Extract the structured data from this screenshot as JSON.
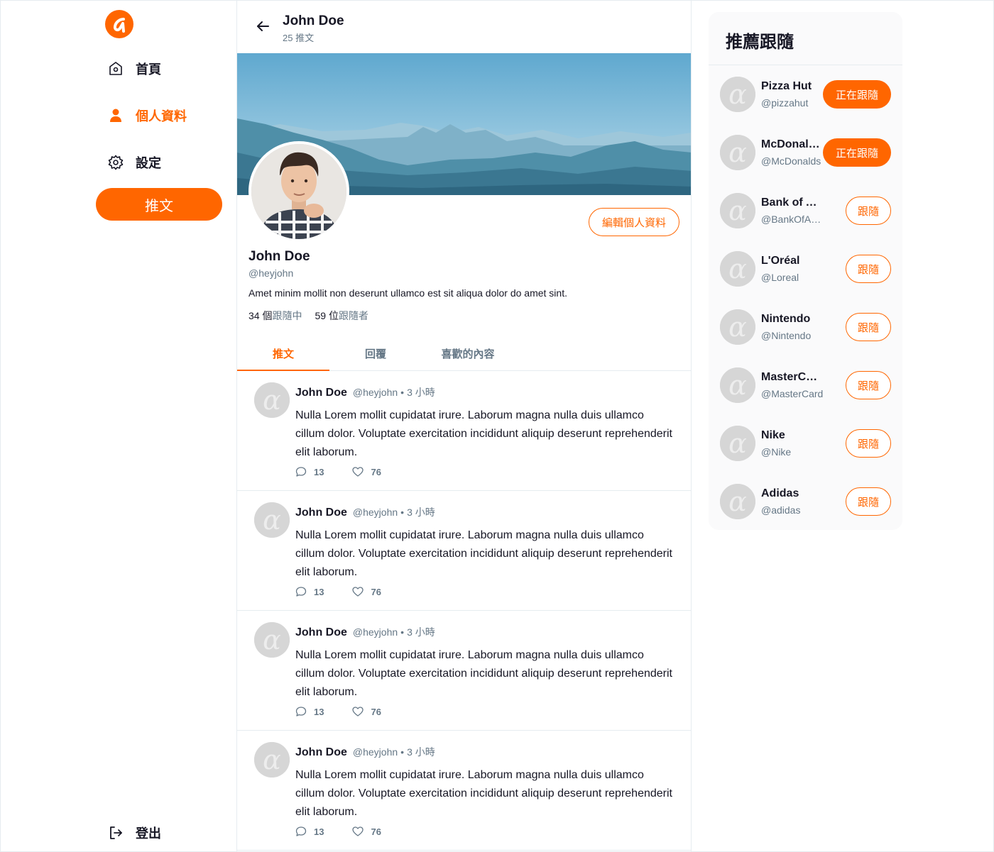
{
  "colors": {
    "accent": "#ff6600",
    "muted": "#657786",
    "border": "#e6ecf0",
    "panel": "#fafafb"
  },
  "sidebar": {
    "logo_icon": "alpha-logo-icon",
    "items": [
      {
        "label": "首頁",
        "icon": "home-icon",
        "active": false
      },
      {
        "label": "個人資料",
        "icon": "user-icon",
        "active": true
      },
      {
        "label": "設定",
        "icon": "gear-icon",
        "active": false
      }
    ],
    "tweet_button": "推文",
    "logout": {
      "label": "登出",
      "icon": "logout-icon"
    }
  },
  "header": {
    "name": "John Doe",
    "tweet_count": "25 推文",
    "back_icon": "arrow-left-icon"
  },
  "profile": {
    "name": "John Doe",
    "handle": "@heyjohn",
    "bio": "Amet minim mollit non deserunt ullamco est sit aliqua dolor do amet sint.",
    "following_count": "34",
    "following_unit": "個",
    "following_label": "跟隨中",
    "followers_count": "59",
    "followers_unit": "位",
    "followers_label": "跟隨者",
    "edit_button": "編輯個人資料"
  },
  "tabs": [
    {
      "label": "推文",
      "active": true
    },
    {
      "label": "回覆",
      "active": false
    },
    {
      "label": "喜歡的內容",
      "active": false
    }
  ],
  "tweets": [
    {
      "name": "John Doe",
      "handle": "@heyjohn",
      "dot": "•",
      "time": "3 小時",
      "body": "Nulla Lorem mollit cupidatat irure. Laborum magna nulla duis ullamco cillum dolor. Voluptate exercitation incididunt aliquip deserunt reprehenderit elit laborum.",
      "replies": "13",
      "likes": "76"
    },
    {
      "name": "John Doe",
      "handle": "@heyjohn",
      "dot": "•",
      "time": "3 小時",
      "body": "Nulla Lorem mollit cupidatat irure. Laborum magna nulla duis ullamco cillum dolor. Voluptate exercitation incididunt aliquip deserunt reprehenderit elit laborum.",
      "replies": "13",
      "likes": "76"
    },
    {
      "name": "John Doe",
      "handle": "@heyjohn",
      "dot": "•",
      "time": "3 小時",
      "body": "Nulla Lorem mollit cupidatat irure. Laborum magna nulla duis ullamco cillum dolor. Voluptate exercitation incididunt aliquip deserunt reprehenderit elit laborum.",
      "replies": "13",
      "likes": "76"
    },
    {
      "name": "John Doe",
      "handle": "@heyjohn",
      "dot": "•",
      "time": "3 小時",
      "body": "Nulla Lorem mollit cupidatat irure. Laborum magna nulla duis ullamco cillum dolor. Voluptate exercitation incididunt aliquip deserunt reprehenderit elit laborum.",
      "replies": "13",
      "likes": "76"
    }
  ],
  "suggestions": {
    "title": "推薦跟隨",
    "items": [
      {
        "name": "Pizza Hut",
        "handle": "@pizzahut",
        "button": "正在跟隨",
        "following": true
      },
      {
        "name": "McDonald's",
        "handle": "@McDonalds",
        "button": "正在跟隨",
        "following": true
      },
      {
        "name": "Bank of America",
        "handle": "@BankOfAmerica",
        "button": "跟隨",
        "following": false
      },
      {
        "name": "L'Oréal",
        "handle": "@Loreal",
        "button": "跟隨",
        "following": false
      },
      {
        "name": "Nintendo",
        "handle": "@Nintendo",
        "button": "跟隨",
        "following": false
      },
      {
        "name": "MasterCard",
        "handle": "@MasterCard",
        "button": "跟隨",
        "following": false
      },
      {
        "name": "Nike",
        "handle": "@Nike",
        "button": "跟隨",
        "following": false
      },
      {
        "name": "Adidas",
        "handle": "@adidas",
        "button": "跟隨",
        "following": false
      }
    ]
  }
}
